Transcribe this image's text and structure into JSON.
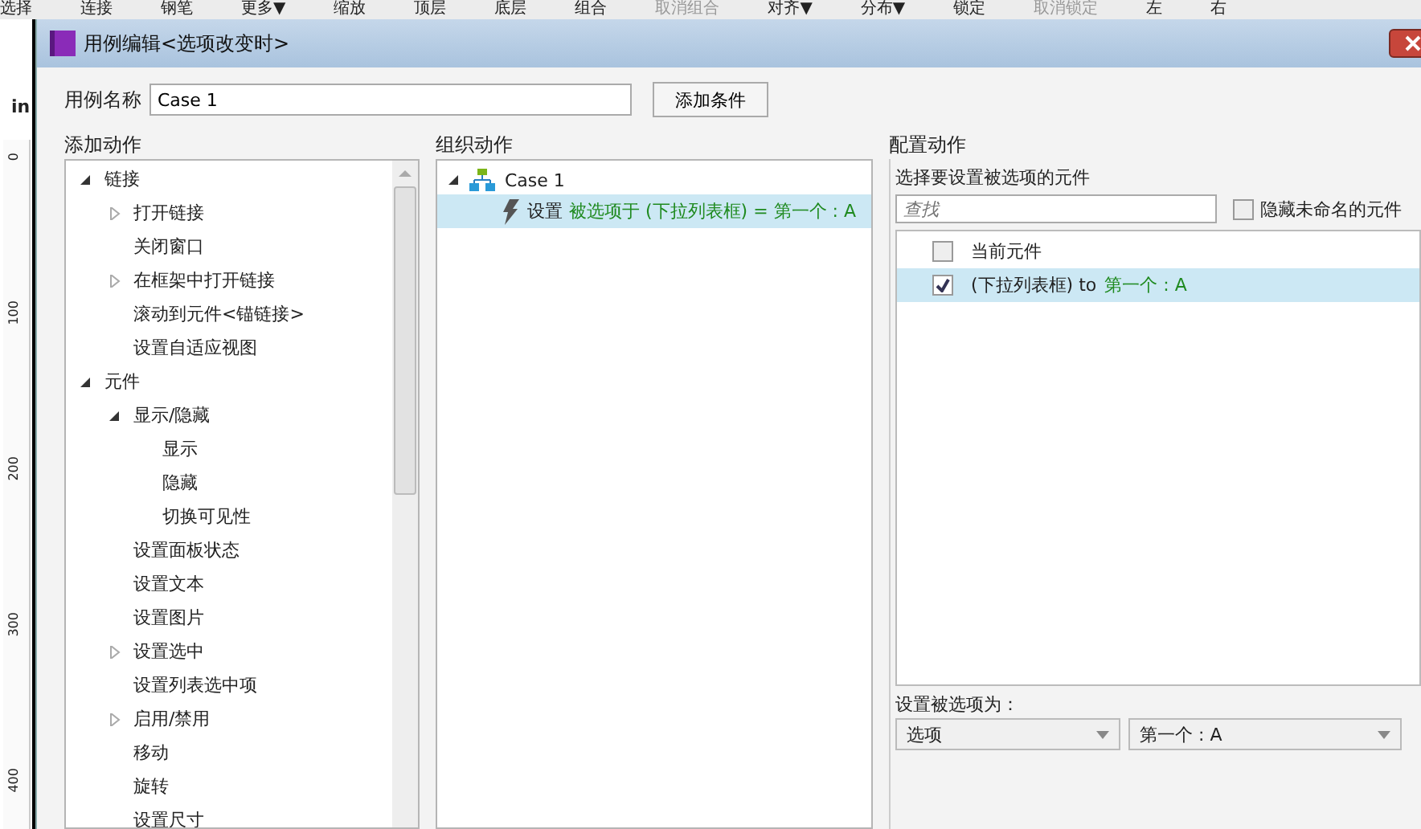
{
  "toolbar": [
    {
      "label": "选择",
      "disabled": false
    },
    {
      "label": "连接",
      "disabled": false
    },
    {
      "label": "钢笔",
      "disabled": false
    },
    {
      "label": "更多▼",
      "disabled": false
    },
    {
      "label": "缩放",
      "disabled": false
    },
    {
      "label": "顶层",
      "disabled": false
    },
    {
      "label": "底层",
      "disabled": false
    },
    {
      "label": "组合",
      "disabled": false
    },
    {
      "label": "取消组合",
      "disabled": true
    },
    {
      "label": "对齐▼",
      "disabled": false
    },
    {
      "label": "分布▼",
      "disabled": false
    },
    {
      "label": "锁定",
      "disabled": false
    },
    {
      "label": "取消锁定",
      "disabled": true
    },
    {
      "label": "左",
      "disabled": false
    },
    {
      "label": "右",
      "disabled": false
    }
  ],
  "background": {
    "tab": "in",
    "ruler": [
      "0",
      "100",
      "200",
      "300",
      "400"
    ]
  },
  "dialog": {
    "title": "用例编辑<选项改变时>",
    "name_label": "用例名称",
    "name_value": "Case 1",
    "add_condition": "添加条件",
    "add_actions": {
      "heading": "添加动作",
      "tree": [
        {
          "label": "链接",
          "expanded": true,
          "children": [
            {
              "label": "打开链接",
              "expanded": false
            },
            {
              "label": "关闭窗口"
            },
            {
              "label": "在框架中打开链接",
              "expanded": false
            },
            {
              "label": "滚动到元件<锚链接>"
            },
            {
              "label": "设置自适应视图"
            }
          ]
        },
        {
          "label": "元件",
          "expanded": true,
          "children": [
            {
              "label": "显示/隐藏",
              "expanded": true,
              "children": [
                {
                  "label": "显示"
                },
                {
                  "label": "隐藏"
                },
                {
                  "label": "切换可见性"
                }
              ]
            },
            {
              "label": "设置面板状态"
            },
            {
              "label": "设置文本"
            },
            {
              "label": "设置图片"
            },
            {
              "label": "设置选中",
              "expanded": false
            },
            {
              "label": "设置列表选中项"
            },
            {
              "label": "启用/禁用",
              "expanded": false
            },
            {
              "label": "移动"
            },
            {
              "label": "旋转"
            },
            {
              "label": "设置尺寸"
            }
          ]
        }
      ]
    },
    "organize": {
      "heading": "组织动作",
      "case": {
        "label": "Case 1",
        "expanded": true
      },
      "actions": [
        {
          "verb": "设置",
          "detail": "被选项于 (下拉列表框) = 第一个 : A",
          "selected": true
        }
      ]
    },
    "configure": {
      "heading": "配置动作",
      "prompt": "选择要设置被选项的元件",
      "search_placeholder": "查找",
      "hide_unnamed": {
        "label": "隐藏未命名的元件",
        "checked": false
      },
      "widgets": [
        {
          "name": "当前元件",
          "checked": false,
          "selected": false
        },
        {
          "name": "(下拉列表框) to",
          "value": "第一个 : A",
          "checked": true,
          "selected": true
        }
      ],
      "set_label": "设置被选项为：",
      "dropdowns": [
        "选项",
        "第一个 : A"
      ]
    }
  }
}
